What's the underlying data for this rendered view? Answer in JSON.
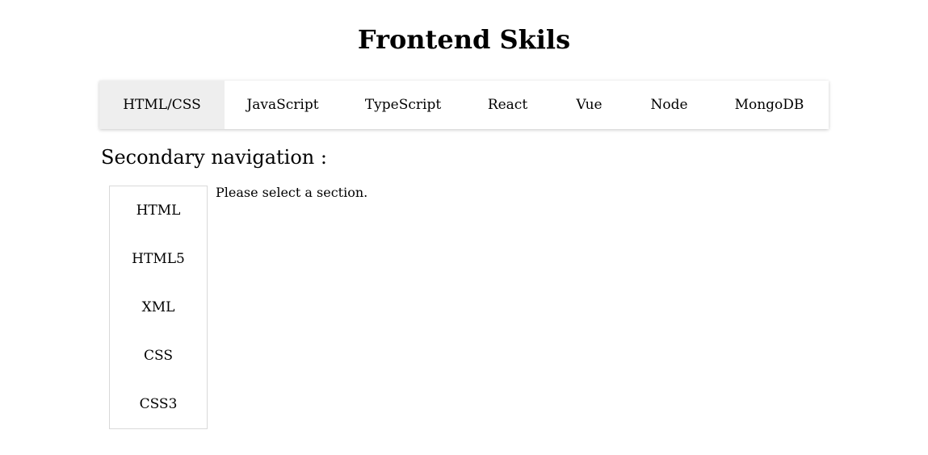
{
  "page": {
    "title": "Frontend Skils"
  },
  "primary_nav": {
    "tabs": [
      {
        "label": "HTML/CSS",
        "active": true
      },
      {
        "label": "JavaScript",
        "active": false
      },
      {
        "label": "TypeScript",
        "active": false
      },
      {
        "label": "React",
        "active": false
      },
      {
        "label": "Vue",
        "active": false
      },
      {
        "label": "Node",
        "active": false
      },
      {
        "label": "MongoDB",
        "active": false
      }
    ]
  },
  "secondary": {
    "heading": "Secondary navigation :",
    "items": [
      {
        "label": "HTML"
      },
      {
        "label": "HTML5"
      },
      {
        "label": "XML"
      },
      {
        "label": "CSS"
      },
      {
        "label": "CSS3"
      }
    ]
  },
  "content": {
    "message": "Please select a section."
  },
  "colors": {
    "active_tab_background": "#eeeeee",
    "nav_background": "#ffffff",
    "secondary_border": "#d9d9d9",
    "text": "#000000"
  }
}
